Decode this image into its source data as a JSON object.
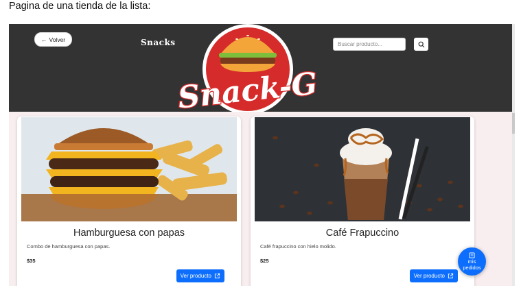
{
  "caption": "Pagina de una tienda de la lista:",
  "header": {
    "back_label": "Volver",
    "title": "Snacks",
    "search_placeholder": "Buscar producto...",
    "logo_text": "Snack-G"
  },
  "products": [
    {
      "name": "Hamburguesa con papas",
      "description": "Combo de hamburguesa con papas.",
      "price": "$35",
      "button_label": "Ver producto"
    },
    {
      "name": "Café Frapuccino",
      "description": "Café frapuccino con hielo molido.",
      "price": "$25",
      "button_label": "Ver producto"
    }
  ],
  "fab": {
    "line1": "mis",
    "line2": "pedidos"
  },
  "colors": {
    "header_bg": "#333333",
    "primary": "#0d6efd",
    "page_bg": "#f8eef0",
    "logo_red": "#d62b2b"
  }
}
